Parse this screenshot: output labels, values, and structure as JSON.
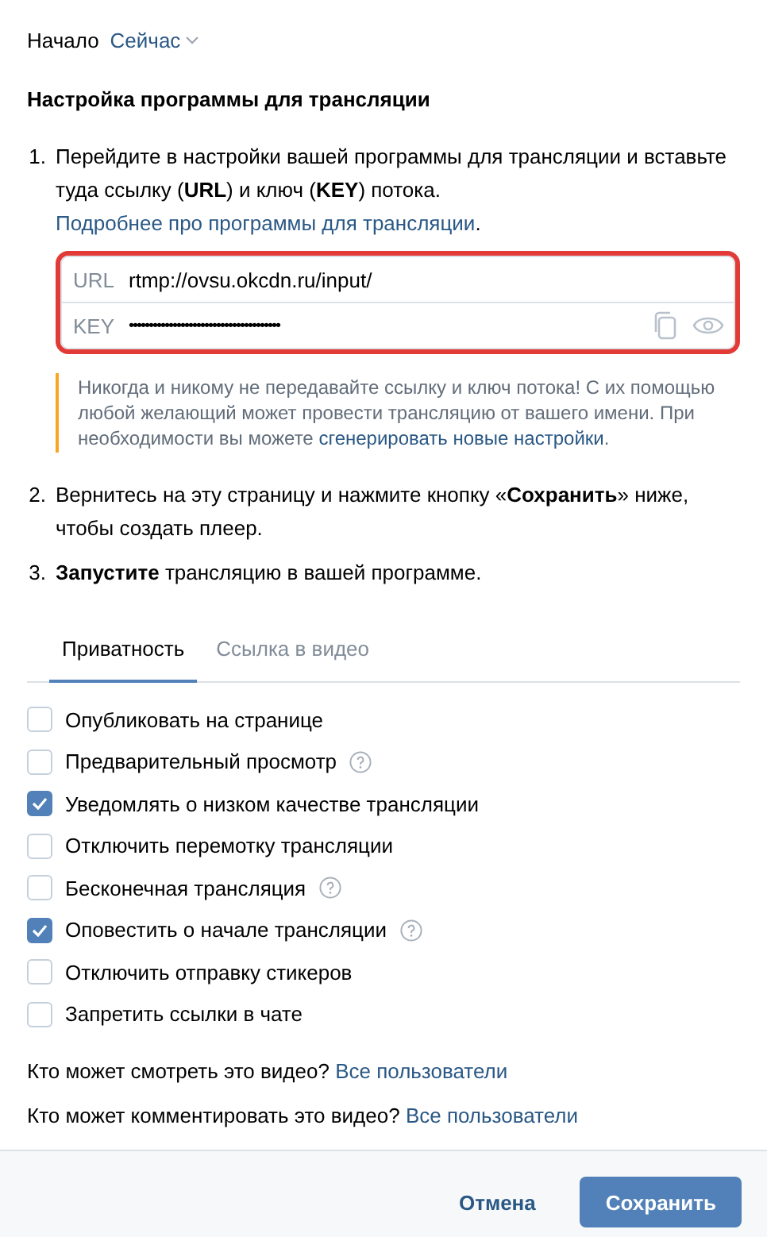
{
  "start": {
    "label": "Начало",
    "value": "Сейчас"
  },
  "setup": {
    "title": "Настройка программы для трансляции",
    "steps": [
      {
        "number": "1.",
        "text": "Перейдите в настройки вашей программы для трансляции и вставьте туда ссылку (**URL**) и ключ (**KEY**) потока.",
        "link": "Подробнее про программы для трансляции",
        "after": "."
      },
      {
        "number": "2.",
        "text": "Вернитесь на эту страницу и нажмите кнопку «**Сохранить**» ниже, чтобы создать плеер."
      },
      {
        "number": "3.",
        "text": "**Запустите** трансляцию в вашей программе."
      }
    ],
    "fields": [
      {
        "kind": "url",
        "label": "URL",
        "value": "rtmp://ovsu.okcdn.ru/input/"
      },
      {
        "kind": "key",
        "label": "KEY",
        "value": "••••••••••••••••••••••••••••••••••••••"
      }
    ],
    "warning": {
      "text": "Никогда и никому не передавайте ссылку и ключ потока! С их помощью любой желающий может провести трансляцию от вашего имени. При необходимости вы можете",
      "link": "сгенерировать новые настройки",
      "after": "."
    }
  },
  "tabs": [
    {
      "label": "Приватность",
      "selected": true
    },
    {
      "label": "Ссылка в видео",
      "selected": false
    }
  ],
  "options": [
    {
      "label": "Опубликовать на странице",
      "checked": false,
      "help": false
    },
    {
      "label": "Предварительный просмотр",
      "checked": false,
      "help": true
    },
    {
      "label": "Уведомлять о низком качестве трансляции",
      "checked": true,
      "help": false
    },
    {
      "label": "Отключить перемотку трансляции",
      "checked": false,
      "help": false
    },
    {
      "label": "Бесконечная трансляция",
      "checked": false,
      "help": true
    },
    {
      "label": "Оповестить о начале трансляции",
      "checked": true,
      "help": true
    },
    {
      "label": "Отключить отправку стикеров",
      "checked": false,
      "help": false
    },
    {
      "label": "Запретить ссылки в чате",
      "checked": false,
      "help": false
    }
  ],
  "access": [
    {
      "question": "Кто может смотреть это видео?",
      "value": "Все пользователи"
    },
    {
      "question": "Кто может комментировать это видео?",
      "value": "Все пользователи"
    }
  ],
  "buttons": [
    {
      "kind": "secondary",
      "label": "Отмена"
    },
    {
      "kind": "primary",
      "label": "Сохранить"
    }
  ]
}
